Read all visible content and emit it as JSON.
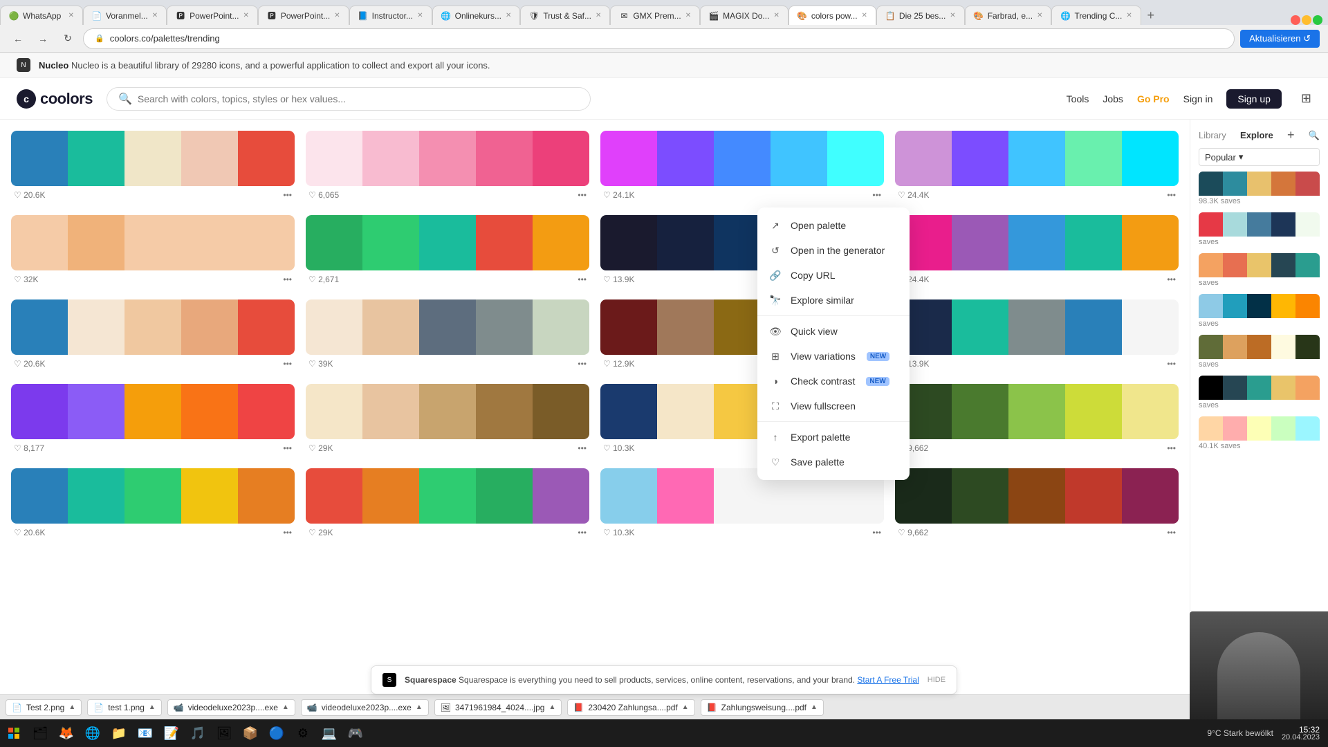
{
  "browser": {
    "tabs": [
      {
        "id": "whatsapp",
        "label": "WhatsApp",
        "icon": "🟢",
        "active": false
      },
      {
        "id": "voranmel",
        "label": "Voranmel...",
        "icon": "📄",
        "active": false
      },
      {
        "id": "powerpoint1",
        "label": "PowerPoint...",
        "icon": "🅿",
        "active": false
      },
      {
        "id": "powerpoint2",
        "label": "PowerPoint...",
        "icon": "🅿",
        "active": false
      },
      {
        "id": "instructor",
        "label": "Instructor...",
        "icon": "📘",
        "active": false
      },
      {
        "id": "onlinekurs",
        "label": "Onlinekurs...",
        "icon": "🌐",
        "active": false
      },
      {
        "id": "trust",
        "label": "Trust & Saf...",
        "icon": "🛡",
        "active": false
      },
      {
        "id": "gmx",
        "label": "GMX Prem...",
        "icon": "✉",
        "active": false
      },
      {
        "id": "magix",
        "label": "MAGIX Do...",
        "icon": "🎬",
        "active": false
      },
      {
        "id": "colors",
        "label": "colors pow...",
        "icon": "🎨",
        "active": true
      },
      {
        "id": "die25",
        "label": "Die 25 bes...",
        "icon": "📋",
        "active": false
      },
      {
        "id": "farbrad",
        "label": "Farbrad, e...",
        "icon": "🎨",
        "active": false
      },
      {
        "id": "trending",
        "label": "Trending C...",
        "icon": "🌐",
        "active": false
      }
    ],
    "url": "coolors.co/palettes/trending"
  },
  "topbar": {
    "logo": "coolors",
    "search_placeholder": "Search with colors, topics, styles or hex values...",
    "nav_links": [
      "Tools",
      "Jobs",
      "Go Pro",
      "Sign in"
    ],
    "signup_label": "Sign up"
  },
  "nucleo_banner": {
    "brand": "Nucleo",
    "text": "Nucleo is a beautiful library of 29280 icons, and a powerful application to collect and export all your icons."
  },
  "right_sidebar": {
    "tab_library": "Library",
    "tab_explore": "Explore",
    "filter_label": "Popular",
    "mini_palettes": [
      {
        "saves": "98.3K saves",
        "colors": [
          "#1b4b5a",
          "#2d8c9e",
          "#e8c16d",
          "#d4763b",
          "#c94b4b"
        ]
      },
      {
        "saves": "saves",
        "colors": [
          "#e63946",
          "#a8dadc",
          "#457b9d",
          "#1d3557",
          "#f1faee"
        ]
      },
      {
        "saves": "saves",
        "colors": [
          "#f4a261",
          "#e76f51",
          "#e9c46a",
          "#264653",
          "#2a9d8f"
        ]
      },
      {
        "saves": "saves",
        "colors": [
          "#8ecae6",
          "#219ebc",
          "#023047",
          "#ffb703",
          "#fb8500"
        ]
      },
      {
        "saves": "saves",
        "colors": [
          "#606c38",
          "#dda15e",
          "#bc6c25",
          "#fefae0",
          "#283618"
        ]
      },
      {
        "saves": "saves",
        "colors": [
          "#000000",
          "#264653",
          "#2a9d8f",
          "#e9c46a",
          "#f4a261"
        ]
      },
      {
        "saves": "40.1K saves",
        "colors": [
          "#ffd6a5",
          "#ffadad",
          "#fdffb6",
          "#caffbf",
          "#9bf6ff"
        ]
      }
    ]
  },
  "context_menu": {
    "items": [
      {
        "label": "Open palette",
        "icon": "external-link"
      },
      {
        "label": "Open in the generator",
        "icon": "generator"
      },
      {
        "label": "Copy URL",
        "icon": "link"
      },
      {
        "label": "Explore similar",
        "icon": "explore"
      },
      {
        "divider": true
      },
      {
        "label": "Quick view",
        "icon": "eye"
      },
      {
        "label": "View variations",
        "icon": "grid",
        "badge": "NEW"
      },
      {
        "label": "Check contrast",
        "icon": "contrast",
        "badge": "NEW"
      },
      {
        "label": "View fullscreen",
        "icon": "fullscreen"
      },
      {
        "divider": true
      },
      {
        "label": "Export palette",
        "icon": "export"
      },
      {
        "label": "Save palette",
        "icon": "heart"
      }
    ]
  },
  "palette_grid": {
    "palettes": [
      {
        "colors": [
          "#2980b9",
          "#1abc9c",
          "#f0e6c8",
          "#f0c8b4",
          "#e74c3c"
        ],
        "likes": "20.6K"
      },
      {
        "colors": [
          "#fce4ec",
          "#f8bbd0",
          "#f48fb1",
          "#f06292",
          "#ec407a"
        ],
        "likes": "6,065"
      },
      {
        "colors": [
          "#e040fb",
          "#7c4dff",
          "#448aff",
          "#40c4ff",
          "#40ffff"
        ],
        "likes": "24.1K"
      },
      {
        "colors": [
          "#ce93d8",
          "#7c4dff",
          "#40c4ff",
          "#69f0ae",
          "#00e5ff"
        ],
        "likes": "24.4K"
      },
      {
        "colors": [
          "#f5cba7",
          "#f0b27a",
          "#f5cba7",
          "#f5cba7",
          "#f5cba7"
        ],
        "likes": "32K"
      },
      {
        "colors": [
          "#27ae60",
          "#2ecc71",
          "#1abc9c",
          "#e74c3c",
          "#f39c12"
        ],
        "likes": "2,671"
      },
      {
        "colors": [
          "#1a1a2e",
          "#16213e",
          "#0f3460",
          "#f5a623",
          "#f5a623"
        ],
        "likes": "13.9K"
      },
      {
        "colors": [
          "#e91e8c",
          "#9b59b6",
          "#3498db",
          "#1abc9c",
          "#f39c12"
        ],
        "likes": "24.4K"
      },
      {
        "colors": [
          "#2980b9",
          "#f5e6d3",
          "#f0c8a0",
          "#e8a87c",
          "#e74c3c"
        ],
        "likes": "20.6K"
      },
      {
        "colors": [
          "#f5e6d3",
          "#e8c4a0",
          "#5d6d7e",
          "#7f8c8d",
          "#c8d6c0"
        ],
        "likes": "39K"
      },
      {
        "colors": [
          "#6b1a1a",
          "#a0785a",
          "#8b6914",
          "#c8a46e",
          "#f5e6c8"
        ],
        "likes": "12.9K"
      },
      {
        "colors": [
          "#1a2a4a",
          "#1abc9c",
          "#7f8c8d",
          "#2980b9",
          "#f5f5f5"
        ],
        "likes": "13.9K"
      },
      {
        "colors": [
          "#7c3aed",
          "#8b5cf6",
          "#f59e0b",
          "#f97316",
          "#ef4444"
        ],
        "likes": "8,177"
      },
      {
        "colors": [
          "#f5e6c8",
          "#e8c4a0",
          "#c8a46e",
          "#a07840",
          "#7a5c28"
        ],
        "likes": "29K"
      },
      {
        "colors": [
          "#1a3a6e",
          "#f5e6c8",
          "#f5c842",
          "#f59e0b",
          "#e84343"
        ],
        "likes": "10.3K"
      },
      {
        "colors": [
          "#2d4a22",
          "#4a7a2e",
          "#8bc34a",
          "#cddc39",
          "#f0e68c"
        ],
        "likes": "9,662"
      },
      {
        "colors": [
          "#2980b9",
          "#1abc9c",
          "#2ecc71",
          "#f1c40f",
          "#e67e22"
        ],
        "likes": "20.6K"
      },
      {
        "colors": [
          "#e74c3c",
          "#e67e22",
          "#2ecc71",
          "#27ae60",
          "#9b59b6"
        ],
        "likes": "29K"
      },
      {
        "colors": [
          "#87ceeb",
          "#ff69b4",
          "#f5f5f5",
          "#f5f5f5",
          "#f5f5f5"
        ],
        "likes": "10.3K"
      },
      {
        "colors": [
          "#1a2a1a",
          "#2d4a22",
          "#8b4513",
          "#c0392b",
          "#8b2252"
        ],
        "likes": "9,662"
      }
    ]
  },
  "squarespace": {
    "brand": "Squarespace",
    "text": "Squarespace is everything you need to sell products, services, online content, reservations, and your brand.",
    "cta": "Start A Free Trial",
    "hide_label": "HIDE"
  },
  "bottom_bar": {
    "files": [
      {
        "name": "Test 2.png",
        "icon": "📄"
      },
      {
        "name": "test 1.png",
        "icon": "📄"
      },
      {
        "name": "videodeluxe2023p....exe",
        "icon": "📹"
      },
      {
        "name": "videodeluxe2023p....exe",
        "icon": "📹"
      },
      {
        "name": "3471961984_4024....jpg",
        "icon": "🖼"
      },
      {
        "name": "230420 Zahlungsa....pdf",
        "icon": "📕"
      },
      {
        "name": "Zahlungsweisung....pdf",
        "icon": "📕"
      }
    ]
  },
  "taskbar": {
    "time": "9°C Stark bewölkt",
    "time_display": "15:32",
    "date_display": "20.04.2023"
  }
}
